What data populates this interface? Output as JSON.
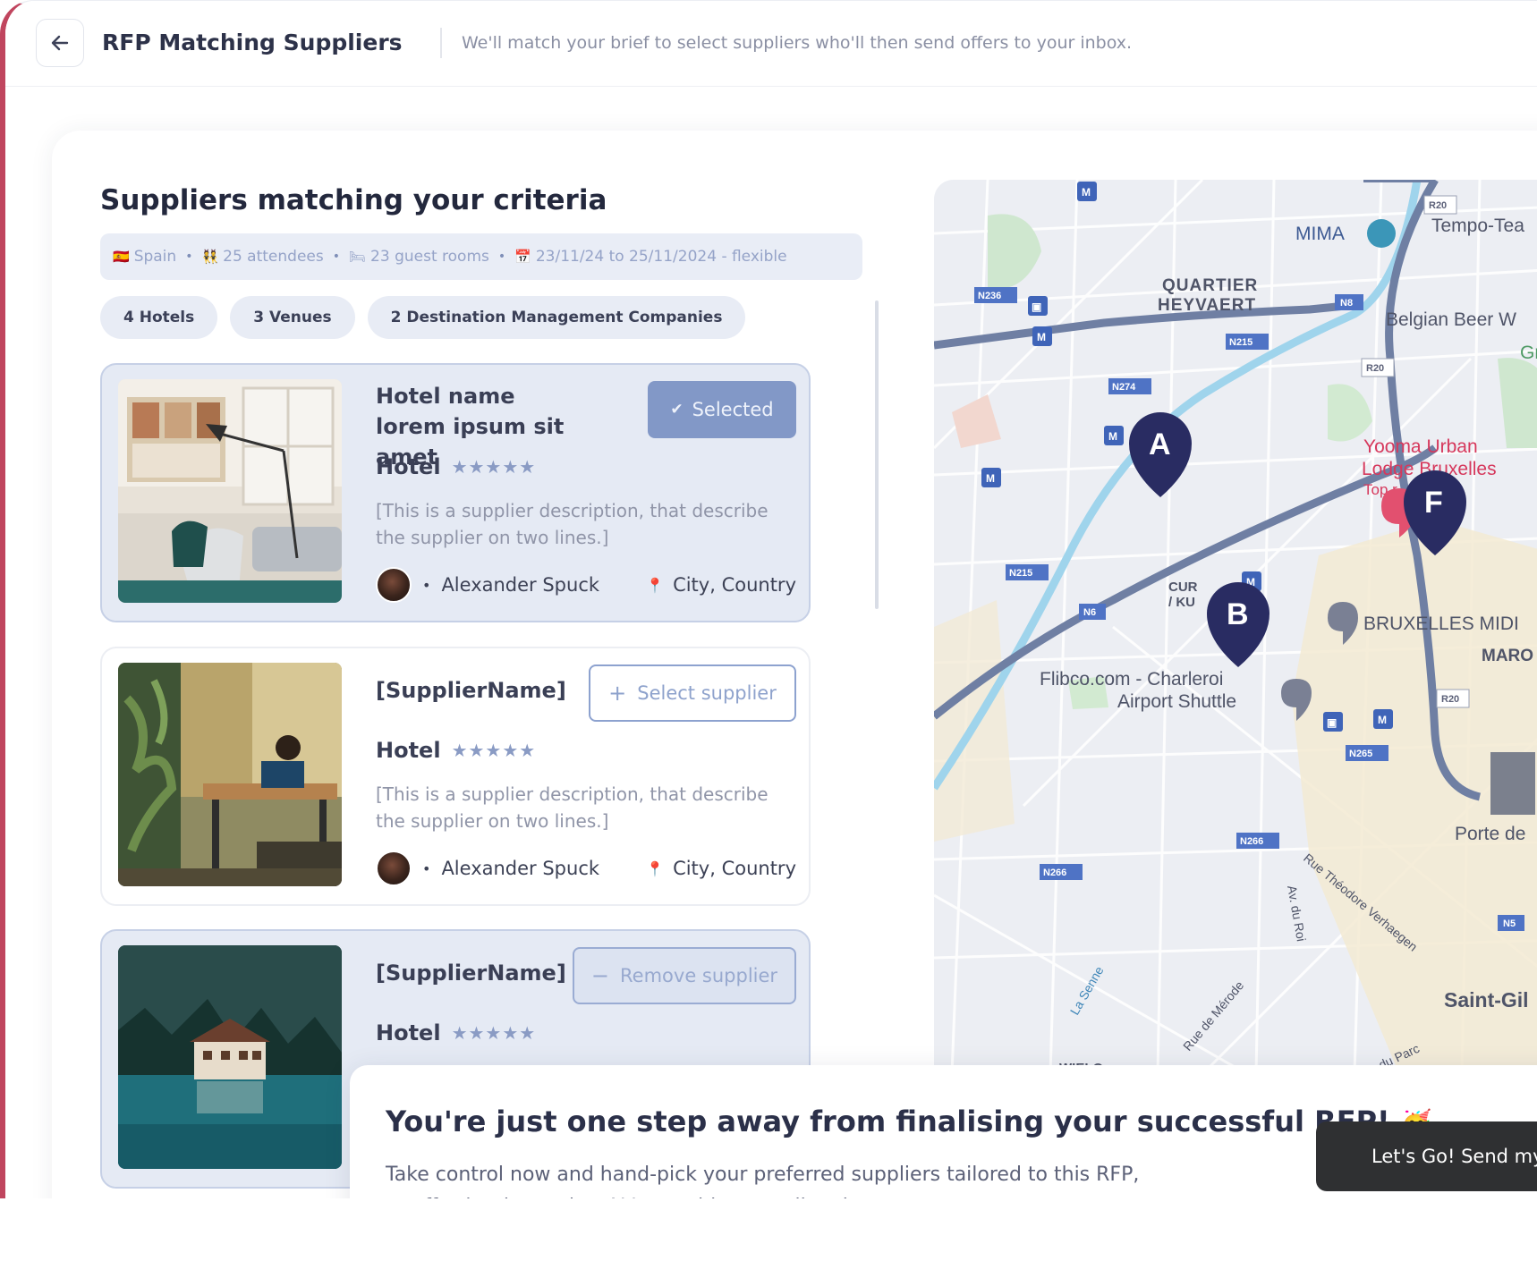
{
  "header": {
    "title": "RFP Matching Suppliers",
    "subtitle": "We'll match your brief to select suppliers who'll then send offers to your inbox."
  },
  "main": {
    "section_title": "Suppliers matching your criteria",
    "criteria": [
      {
        "icon": "spain-flag-icon",
        "glyph": "🇪🇸",
        "label": "Spain"
      },
      {
        "icon": "attendees-icon",
        "glyph": "👯",
        "label": "25 attendees"
      },
      {
        "icon": "bed-icon",
        "glyph": "🛏",
        "label": "23 guest rooms"
      },
      {
        "icon": "calendar-icon",
        "glyph": "📅",
        "label": "23/11/24 to 25/11/2024 - flexible"
      }
    ],
    "chips": [
      "4 Hotels",
      "3 Venues",
      "2 Destination Management Companies"
    ],
    "cards": [
      {
        "name": "Hotel name lorem ipsum sit amet",
        "type": "Hotel",
        "stars": "★★★★★",
        "description": "[This is a supplier description, that describe the supplier on two lines.]",
        "contact": "Alexander Spuck",
        "location": "City, Country",
        "action_label": "Selected",
        "state": "selected"
      },
      {
        "name": "[SupplierName]",
        "type": "Hotel",
        "stars": "★★★★★",
        "description": "[This is a supplier description, that describe the supplier on two lines.]",
        "contact": "Alexander Spuck",
        "location": "City, Country",
        "action_label": "Select supplier",
        "state": "default"
      },
      {
        "name": "[SupplierName]",
        "type": "Hotel",
        "stars": "★★★★★",
        "action_label": "Remove supplier",
        "state": "selected"
      }
    ]
  },
  "map": {
    "markers": [
      "A",
      "B",
      "F"
    ],
    "labels": {
      "mima": "MIMA",
      "tempo": "Tempo-Tea",
      "quartier_1": "QUARTIER",
      "quartier_2": "HEYVAERT",
      "beer": "Belgian Beer W",
      "gr": "Gr",
      "yooma_1": "Yooma Urban",
      "yooma_2": "Lodge Bruxelles",
      "top": "Top r",
      "midi": "BRUXELLES MIDI",
      "marolles": "MARO",
      "flibco_1": "Flibco.com - Charleroi",
      "flibco_2": "Airport Shuttle",
      "cur_1": "CUR",
      "cur_2": "/ KU",
      "porte": "Porte de",
      "saint": "Saint-Gil",
      "theodore": "Rue Théodore Verhaegen",
      "roi": "Av. du Roi",
      "merode": "Rue de Mérode",
      "senne": "La Senne",
      "parc": "du Parc",
      "wielo": "WIELO"
    },
    "road_tags": [
      "R20",
      "N236",
      "N8",
      "N215",
      "N274",
      "R20",
      "N215",
      "N6",
      "N265",
      "N266",
      "N266",
      "R20",
      "N5"
    ]
  },
  "banner": {
    "title": "You're just one step away from finalising your successful RFP!",
    "emoji": "🥳",
    "text_line1": "Take control now and hand-pick your preferred suppliers tailored to this RFP,",
    "text_line2": "or effortlessly send to ALL matching suppliers in one go.",
    "button_label": "Let's Go! Send my"
  }
}
